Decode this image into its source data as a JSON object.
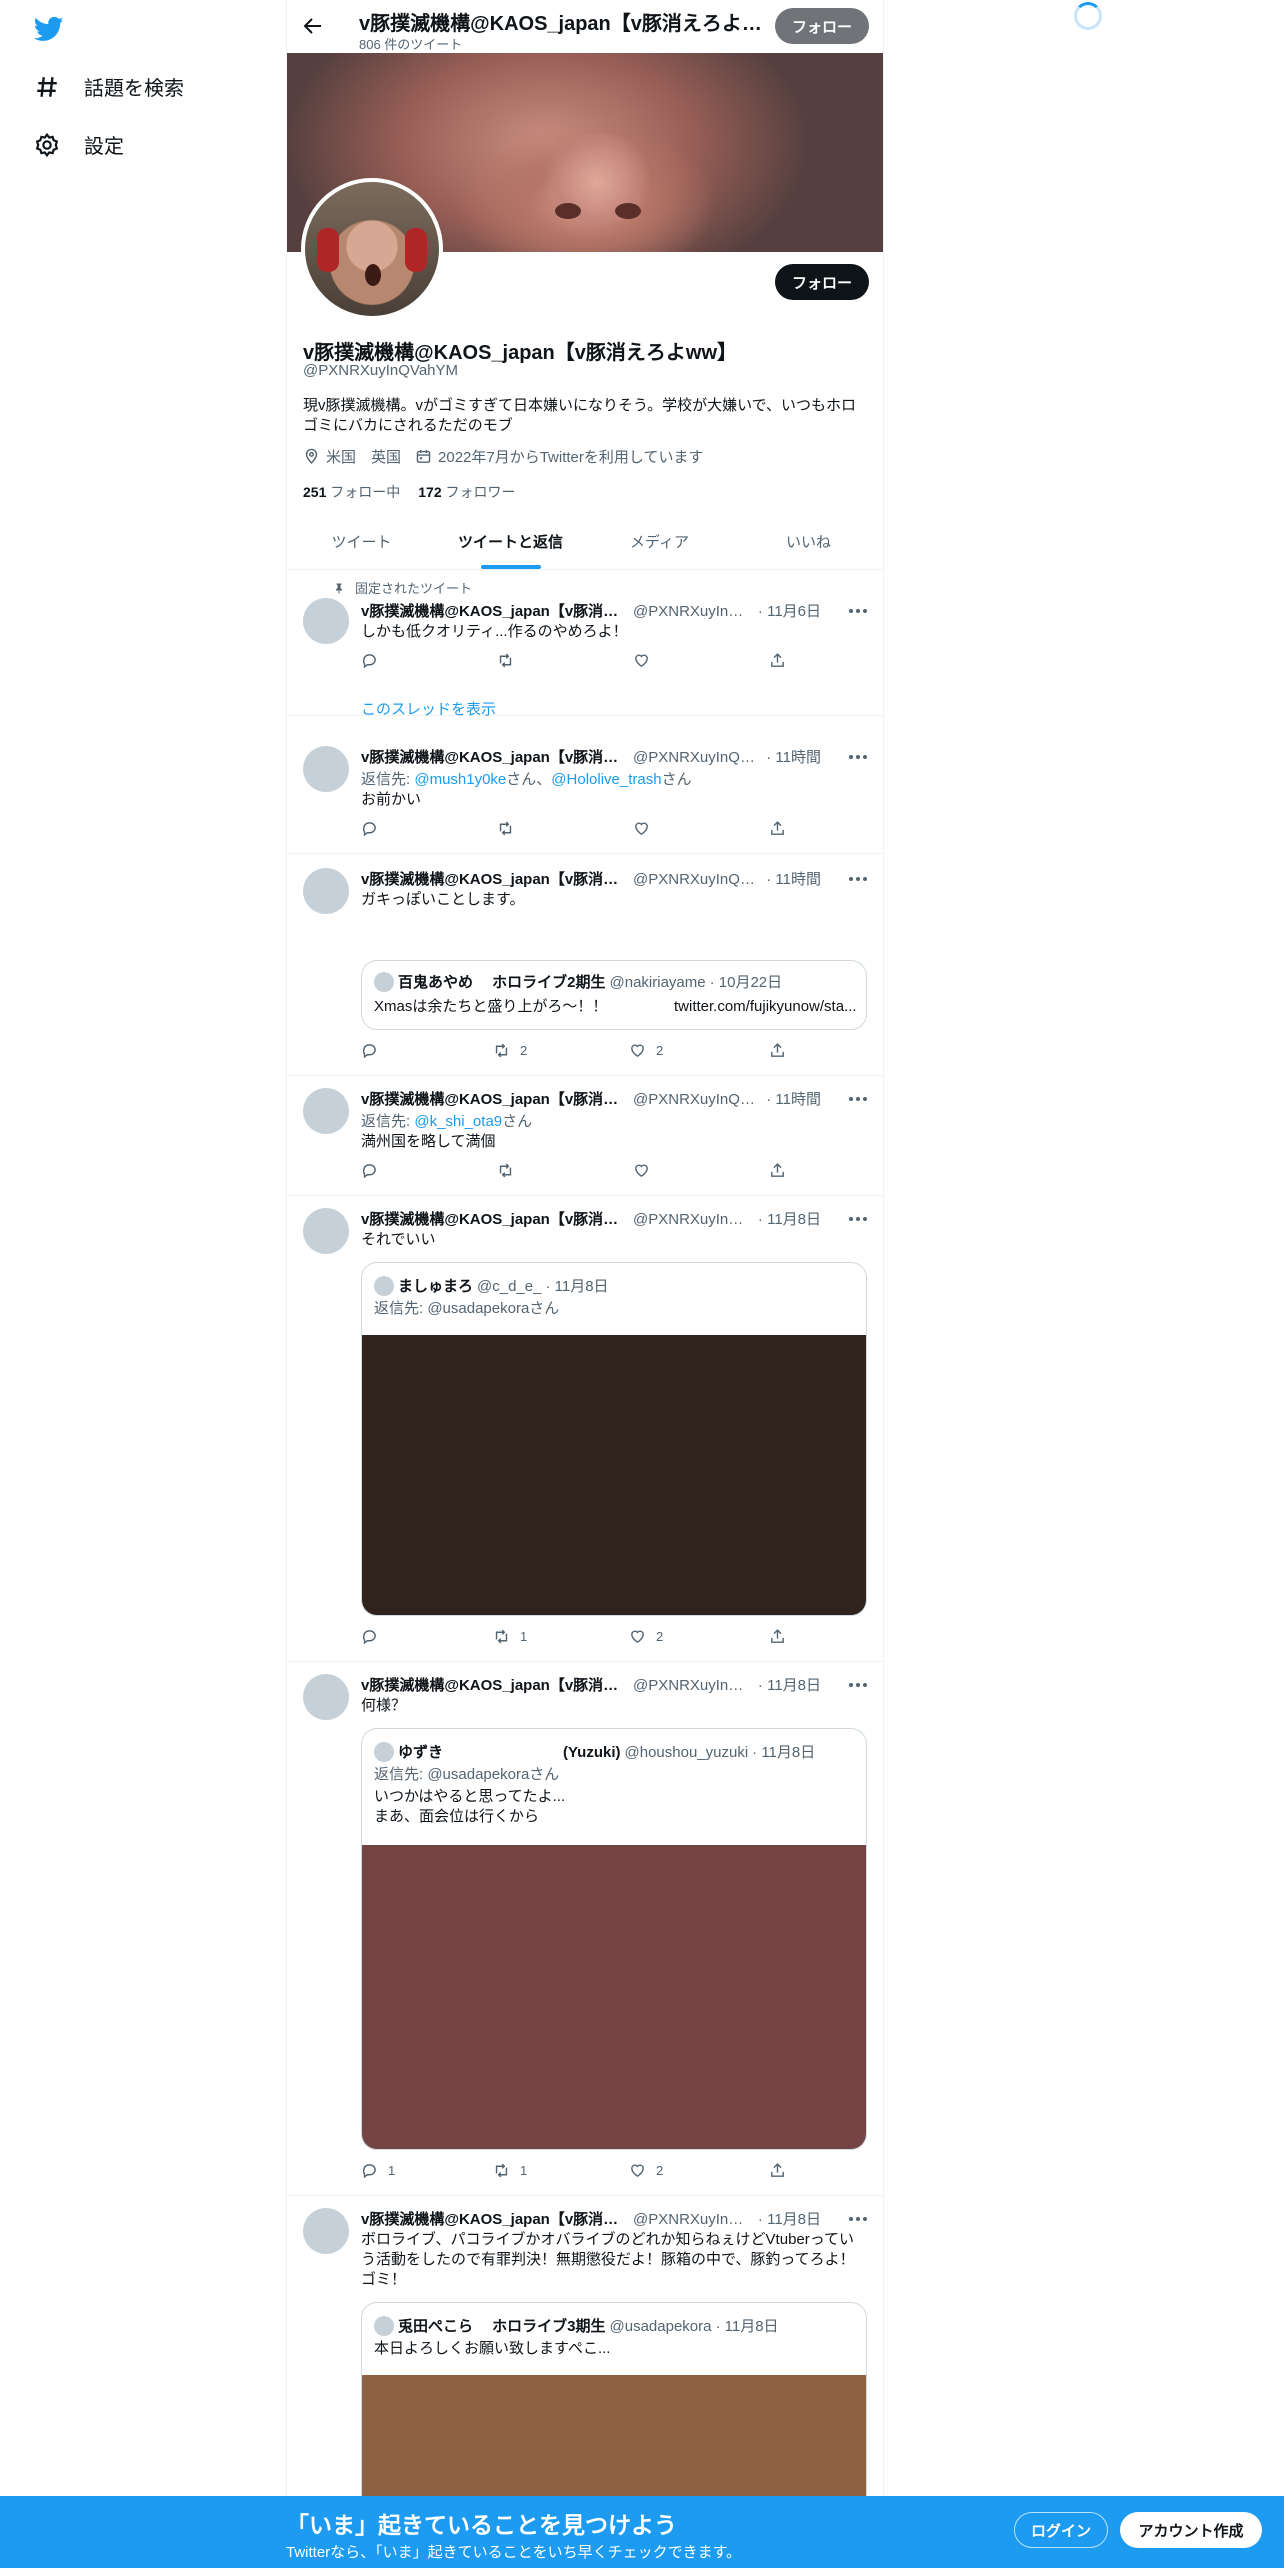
{
  "sidebar": {
    "items": [
      {
        "label": "話題を検索",
        "icon": "hashtag-icon"
      },
      {
        "label": "設定",
        "icon": "gear-icon"
      }
    ]
  },
  "header": {
    "title": "v豚撲滅機構@KAOS_japan【v豚消えろよww】",
    "tweet_count": "806 件のツイート",
    "follow_label": "フォロー"
  },
  "profile": {
    "name": "v豚撲滅機構@KAOS_japan【v豚消えろよww】",
    "handle": "@PXNRXuyInQVahYM",
    "bio": "現v豚撲滅機構。vがゴミすぎて日本嫌いになりそう。学校が大嫌いで、いつもホロゴミにバカにされるただのモブ",
    "location": "米国　英国",
    "joined": "2022年7月からTwitterを利用しています",
    "following_count": "251",
    "following_label": "フォロー中",
    "followers_count": "172",
    "followers_label": "フォロワー",
    "follow_label": "フォロー"
  },
  "tabs": [
    {
      "label": "ツイート",
      "active": false
    },
    {
      "label": "ツイートと返信",
      "active": true
    },
    {
      "label": "メディア",
      "active": false
    },
    {
      "label": "いいね",
      "active": false
    }
  ],
  "tweets": [
    {
      "pinned_label": "固定されたツイート",
      "name": "v豚撲滅機構@KAOS_japan【v豚消え...",
      "handle": "@PXNRXuyInQ...",
      "time": "· 11月6日",
      "text": "しかも低クオリティ...作るのやめろよ！",
      "replies": "",
      "retweets": "",
      "likes": "",
      "thread_link": "このスレッドを表示"
    },
    {
      "name": "v豚撲滅機構@KAOS_japan【v豚消え...",
      "handle": "@PXNRXuyInQV...",
      "time": "· 11時間",
      "reply_prefix": "返信先: ",
      "reply_user1": "@mush1y0ke",
      "reply_mid": "さん、",
      "reply_user2": "@Hololive_trash",
      "reply_suffix": "さん",
      "text": "お前かい",
      "replies": "",
      "retweets": "",
      "likes": ""
    },
    {
      "name": "v豚撲滅機構@KAOS_japan【v豚消え...",
      "handle": "@PXNRXuyInQV...",
      "time": "· 11時間",
      "text": "ガキっぽいことします。",
      "quote": {
        "name": "百鬼あやめ　 ホロライブ2期生",
        "handle": "@nakiriayame",
        "time": "· 10月22日",
        "text": "Xmasは余たちと盛り上がろ〜！！",
        "link": "twitter.com/fujikyunow/sta..."
      },
      "replies": "",
      "retweets": "2",
      "likes": "2"
    },
    {
      "name": "v豚撲滅機構@KAOS_japan【v豚消え...",
      "handle": "@PXNRXuyInQV...",
      "time": "· 11時間",
      "reply_prefix": "返信先: ",
      "reply_user1": "@k_shi_ota9",
      "reply_suffix": "さん",
      "text": "満州国を略して満個",
      "replies": "",
      "retweets": "",
      "likes": ""
    },
    {
      "name": "v豚撲滅機構@KAOS_japan【v豚消え...",
      "handle": "@PXNRXuyInQ...",
      "time": "· 11月8日",
      "text": "それでいい",
      "quote": {
        "name": "ましゅまろ",
        "handle": "@c_d_e_",
        "time": "· 11月8日",
        "reply_to": "返信先: @usadapekoraさん",
        "media_color": "#30221c"
      },
      "replies": "",
      "retweets": "1",
      "likes": "2"
    },
    {
      "name": "v豚撲滅機構@KAOS_japan【v豚消え...",
      "handle": "@PXNRXuyInQ...",
      "time": "· 11月8日",
      "text": "何様？",
      "quote": {
        "name": "ゆずき　　　　　　　　(Yuzuki)",
        "handle": "@houshou_yuzuki",
        "time": "· 11月8日",
        "reply_to": "返信先: @usadapekoraさん",
        "text_line1": "いつかはやると思ってたよ...",
        "text_line2": "まあ、面会位は行くから",
        "media_color": "#744444"
      },
      "replies": "1",
      "retweets": "1",
      "likes": "2"
    },
    {
      "name": "v豚撲滅機構@KAOS_japan【v豚消え...",
      "handle": "@PXNRXuyInQ...",
      "time": "· 11月8日",
      "text": "ボロライブ、パコライブかオバライブのどれか知らねぇけどVtuberっていう活動をしたので有罪判決！無期懲役だよ！豚箱の中で、豚釣ってろよ！ゴミ！",
      "quote": {
        "name": "兎田ぺこら　 ホロライブ3期生",
        "handle": "@usadapekora",
        "time": "· 11月8日",
        "text": "本日よろしくお願い致しますぺこ...",
        "media_color": "#8e6044"
      }
    }
  ],
  "signup": {
    "title": "「いま」起きていることを見つけよう",
    "subtitle": "Twitterなら、「いま」起きていることをいち早くチェックできます。",
    "login_label": "ログイン",
    "create_label": "アカウント作成"
  },
  "colors": {
    "accent": "#1d9bf0",
    "text": "#0f1419",
    "muted": "#536471",
    "border": "#eff3f4"
  }
}
